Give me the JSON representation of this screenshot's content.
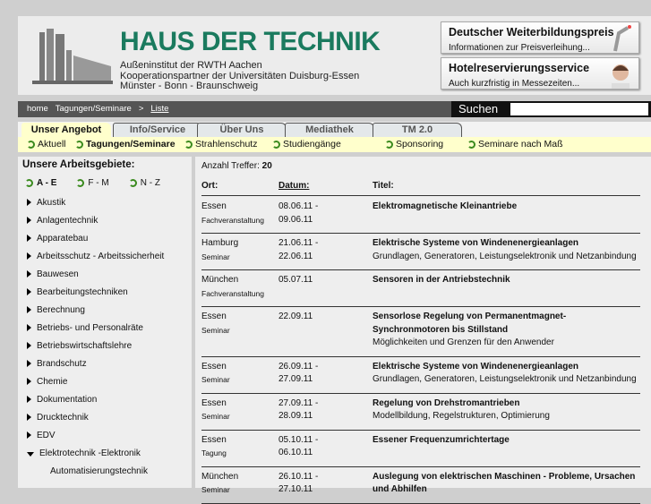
{
  "header": {
    "brand": "HAUS DER TECHNIK",
    "sub": [
      "Außeninstitut der RWTH Aachen",
      "Kooperationspartner der Universitäten Duisburg-Essen",
      "Münster - Bonn - Braunschweig"
    ],
    "promos": [
      {
        "title": "Deutscher Weiterbildungspreis",
        "text": "Informationen zur Preisverleihung..."
      },
      {
        "title": "Hotelreservierungsservice",
        "text": "Auch kurzfristig in Messezeiten..."
      }
    ]
  },
  "breadcrumb": [
    "home",
    "Tagungen/Seminare",
    ">",
    "Liste"
  ],
  "search": {
    "label": "Suchen",
    "value": ""
  },
  "tabs": [
    "Unser Angebot",
    "Info/Service",
    "Über Uns",
    "Mediathek",
    "TM 2.0"
  ],
  "subnav": [
    "Aktuell",
    "Tagungen/Seminare",
    "Strahlenschutz",
    "Studiengänge",
    "Sponsoring",
    "Seminare nach Maß"
  ],
  "sidebar": {
    "title": "Unsere Arbeitsgebiete:",
    "ranges": [
      "A - E",
      "F - M",
      "N - Z"
    ],
    "items": [
      "Akustik",
      "Anlagentechnik",
      "Apparatebau",
      "Arbeitsschutz - Arbeitssicherheit",
      "Bauwesen",
      "Bearbeitungstechniken",
      "Berechnung",
      "Betriebs- und Personalräte",
      "Betriebswirtschaftslehre",
      "Brandschutz",
      "Chemie",
      "Dokumentation",
      "Drucktechnik",
      "EDV",
      "Elektrotechnik -Elektronik"
    ],
    "subitems": [
      "Automatisierungstechnik"
    ]
  },
  "results": {
    "count_label": "Anzahl Treffer:",
    "count": "20",
    "headers": [
      "Ort:",
      "Datum:",
      "Titel:"
    ],
    "rows": [
      {
        "ort": "Essen",
        "typ": "Fachveranstaltung",
        "d1": "08.06.11 -",
        "d2": "09.06.11",
        "title": "Elektromagnetische Kleinantriebe",
        "sub": ""
      },
      {
        "ort": "Hamburg",
        "typ": "Seminar",
        "d1": "21.06.11 -",
        "d2": "22.06.11",
        "title": "Elektrische Systeme von Windenenergieanlagen",
        "sub": "Grundlagen, Generatoren, Leistungselektronik und Netzanbindung"
      },
      {
        "ort": "München",
        "typ": "Fachveranstaltung",
        "d1": "05.07.11",
        "d2": "",
        "title": "Sensoren in der Antriebstechnik",
        "sub": ""
      },
      {
        "ort": "Essen",
        "typ": "Seminar",
        "d1": "22.09.11",
        "d2": "",
        "title": "Sensorlose Regelung von Permanentmagnet-\nSynchronmotoren bis Stillstand",
        "sub": "Möglichkeiten und Grenzen für den Anwender"
      },
      {
        "ort": "Essen",
        "typ": "Seminar",
        "d1": "26.09.11 -",
        "d2": "27.09.11",
        "title": "Elektrische Systeme von Windenenergieanlagen",
        "sub": "Grundlagen, Generatoren, Leistungselektronik und Netzanbindung"
      },
      {
        "ort": "Essen",
        "typ": "Seminar",
        "d1": "27.09.11 -",
        "d2": "28.09.11",
        "title": "Regelung von Drehstromantrieben",
        "sub": "Modellbildung, Regelstrukturen, Optimierung"
      },
      {
        "ort": "Essen",
        "typ": "Tagung",
        "d1": "05.10.11 -",
        "d2": "06.10.11",
        "title": "Essener Frequenzumrichtertage",
        "sub": ""
      },
      {
        "ort": "München",
        "typ": "Seminar",
        "d1": "26.10.11 -",
        "d2": "27.10.11",
        "title": "Auslegung von elektrischen Maschinen - Probleme, Ursachen\nund Abhilfen",
        "sub": ""
      }
    ]
  }
}
